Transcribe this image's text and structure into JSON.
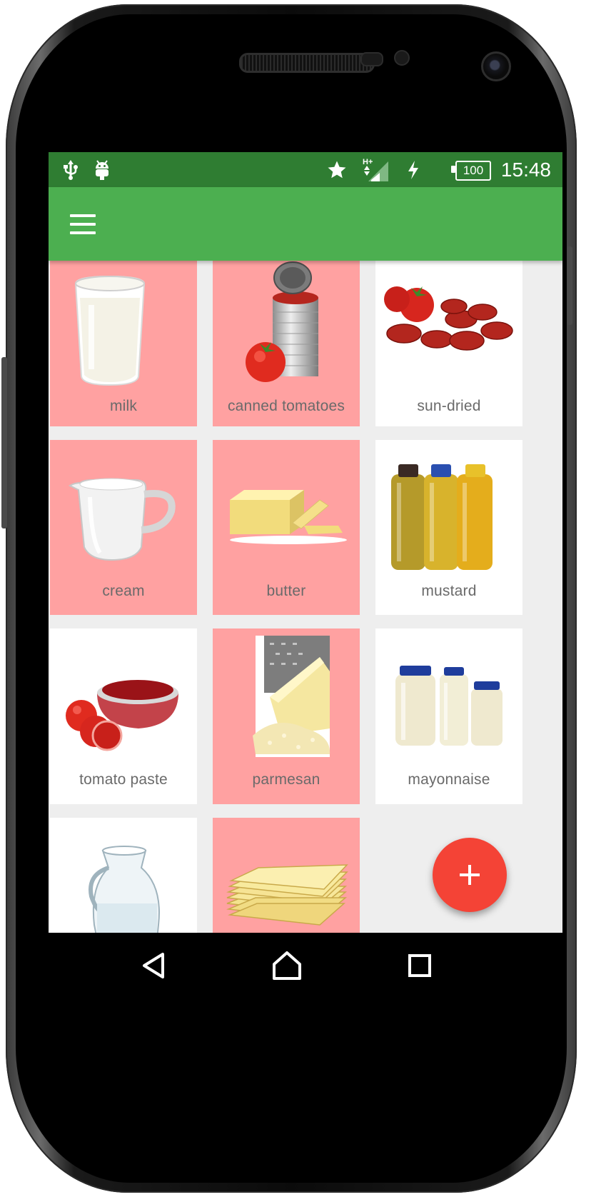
{
  "device": {
    "name": "android-phone"
  },
  "status_bar": {
    "time": "15:48",
    "battery_level": "100",
    "network_type": "H+",
    "icons": [
      "usb-icon",
      "android-debug-icon",
      "star-icon",
      "signal-icon",
      "charging-icon",
      "battery-icon"
    ],
    "color": "#2f7d32"
  },
  "toolbar": {
    "menu_icon": "hamburger-menu-icon",
    "color": "#4caf50"
  },
  "grid": {
    "selected_color": "#ffa1a1",
    "items": [
      {
        "label": "milk",
        "selected": true,
        "icon": "milk-glass-image"
      },
      {
        "label": "canned tomatoes",
        "selected": true,
        "icon": "canned-tomatoes-image"
      },
      {
        "label": "sun-dried",
        "selected": false,
        "icon": "sun-dried-tomatoes-image"
      },
      {
        "label": "cream",
        "selected": true,
        "icon": "cream-jug-image"
      },
      {
        "label": "butter",
        "selected": true,
        "icon": "butter-image"
      },
      {
        "label": "mustard",
        "selected": false,
        "icon": "mustard-bottles-image"
      },
      {
        "label": "tomato paste",
        "selected": false,
        "icon": "tomato-paste-image"
      },
      {
        "label": "parmesan",
        "selected": true,
        "icon": "parmesan-image"
      },
      {
        "label": "mayonnaise",
        "selected": false,
        "icon": "mayonnaise-jars-image"
      },
      {
        "label": "",
        "selected": false,
        "icon": "water-jug-image"
      },
      {
        "label": "",
        "selected": true,
        "icon": "lasagna-sheets-image"
      }
    ]
  },
  "fab": {
    "icon": "plus-icon",
    "color": "#f44336"
  },
  "nav_bar": {
    "buttons": [
      "back-icon",
      "home-icon",
      "recents-icon"
    ]
  }
}
